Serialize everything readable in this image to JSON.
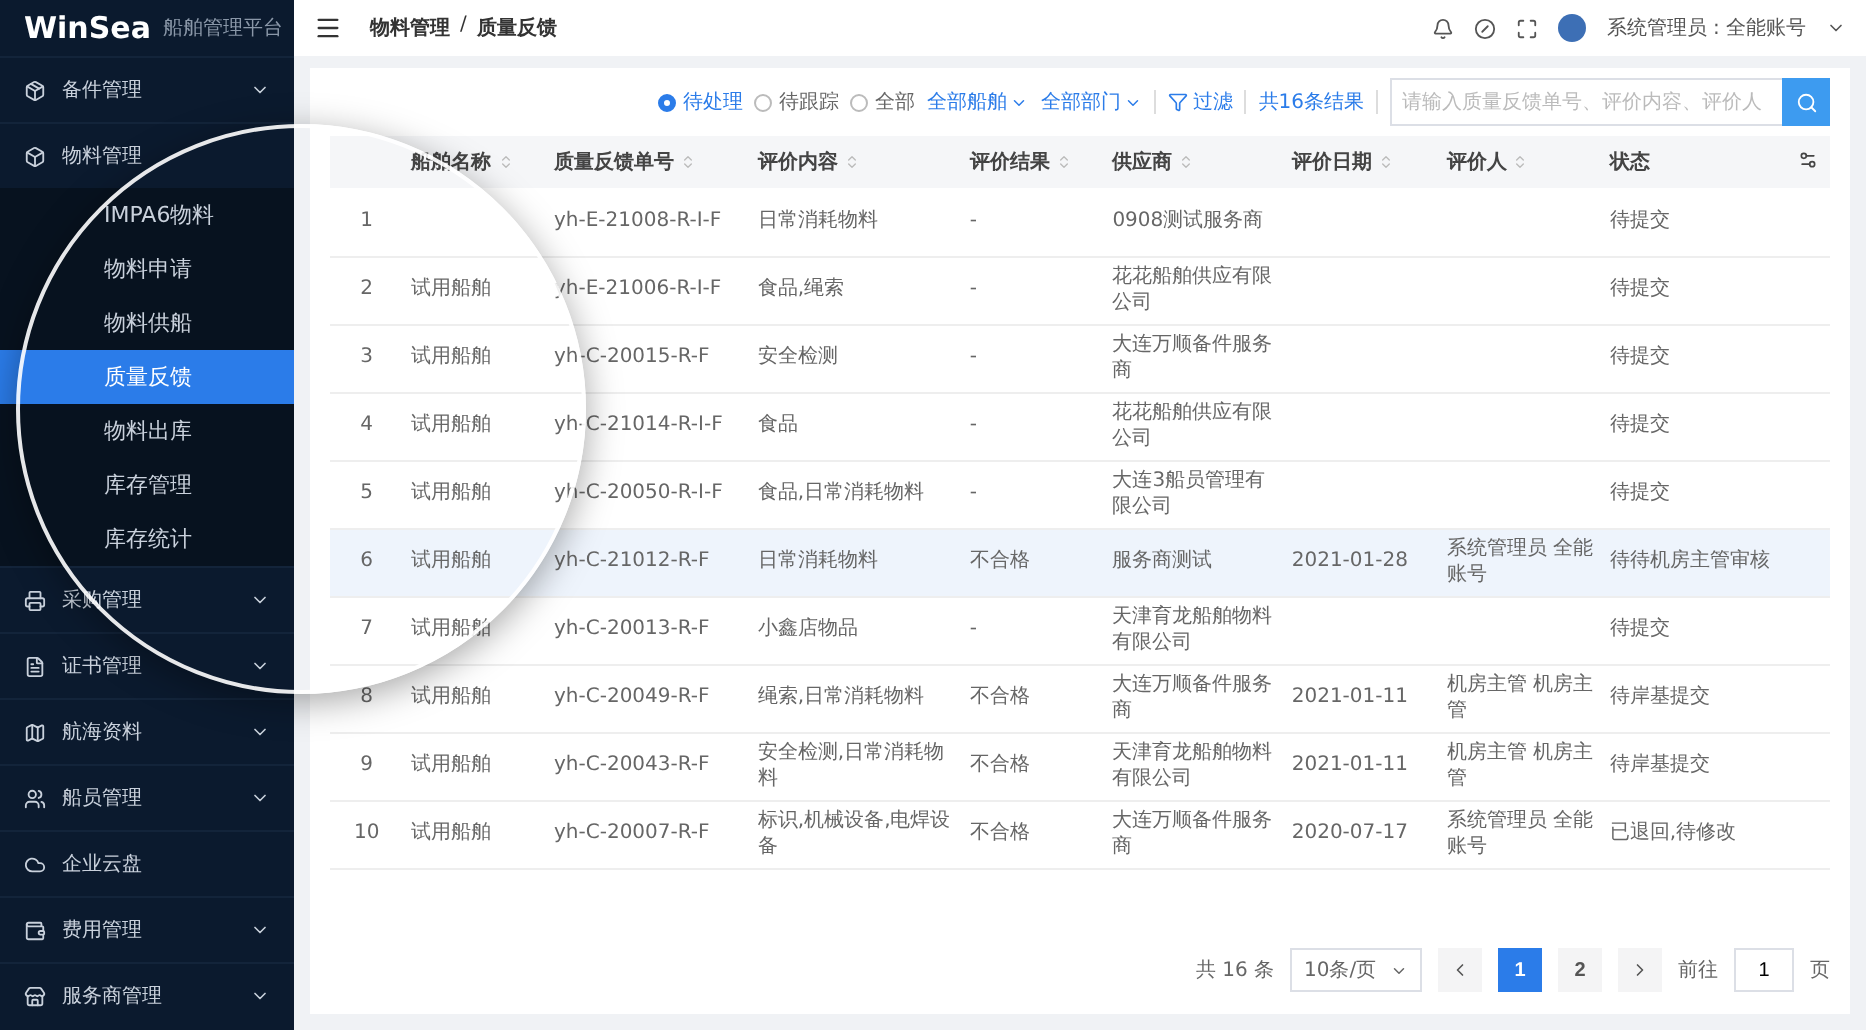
{
  "sidebar": {
    "logo": "WinSea",
    "subtitle": "船舶管理平台",
    "items": [
      {
        "label": "备件管理",
        "arrow": true,
        "expanded": false
      },
      {
        "label": "物料管理",
        "arrow": false,
        "expanded": true,
        "children": [
          {
            "label": "IMPA6物料",
            "selected": false
          },
          {
            "label": "物料申请",
            "selected": false
          },
          {
            "label": "物料供船",
            "selected": false
          },
          {
            "label": "质量反馈",
            "selected": true
          },
          {
            "label": "物料出库",
            "selected": false
          },
          {
            "label": "库存管理",
            "selected": false
          },
          {
            "label": "库存统计",
            "selected": false
          }
        ]
      },
      {
        "label": "采购管理",
        "arrow": true,
        "expanded": false
      },
      {
        "label": "证书管理",
        "arrow": true,
        "expanded": false
      },
      {
        "label": "航海资料",
        "arrow": true,
        "expanded": false
      },
      {
        "label": "船员管理",
        "arrow": true,
        "expanded": false
      },
      {
        "label": "企业云盘",
        "arrow": false,
        "expanded": false
      },
      {
        "label": "费用管理",
        "arrow": true,
        "expanded": false
      },
      {
        "label": "服务商管理",
        "arrow": true,
        "expanded": false
      }
    ]
  },
  "header": {
    "breadcrumb": [
      "物料管理",
      "质量反馈"
    ],
    "separator": "/",
    "user": "系统管理员 : 全能账号"
  },
  "toolbar": {
    "radios": [
      {
        "label": "待处理",
        "selected": true
      },
      {
        "label": "待跟踪",
        "selected": false
      },
      {
        "label": "全部",
        "selected": false
      }
    ],
    "dropdowns": [
      "全部船舶",
      "全部部门"
    ],
    "filter": "过滤",
    "count": "共16条结果",
    "search": {
      "placeholder": "请输入质量反馈单号、评价内容、评价人"
    }
  },
  "table": {
    "columns": [
      "",
      "船舶名称",
      "质量反馈单号",
      "评价内容",
      "评价结果",
      "供应商",
      "评价日期",
      "评价人",
      "状态"
    ],
    "rows": [
      {
        "index": "1",
        "order_no": "yh-E-21008-R-I-F",
        "content": "日常消耗物料",
        "result": "-",
        "supplier": "0908测试服务商",
        "status": "待提交",
        "highlighted": false
      },
      {
        "index": "2",
        "ship": "试用船舶",
        "order_no": "yh-E-21006-R-I-F",
        "content": "食品,绳索",
        "result": "-",
        "supplier": "花花船舶供应有限公司",
        "status": "待提交",
        "highlighted": false
      },
      {
        "index": "3",
        "ship": "试用船舶",
        "order_no": "yh-C-20015-R-F",
        "content": "安全检测",
        "result": "-",
        "supplier": "大连万顺备件服务商",
        "status": "待提交",
        "highlighted": false
      },
      {
        "index": "4",
        "ship": "试用船舶",
        "order_no": "yh-C-21014-R-I-F",
        "content": "食品",
        "result": "-",
        "supplier": "花花船舶供应有限公司",
        "status": "待提交",
        "highlighted": false
      },
      {
        "index": "5",
        "ship": "试用船舶",
        "order_no": "yh-C-20050-R-I-F",
        "content": "食品,日常消耗物料",
        "result": "-",
        "supplier": "大连3船员管理有限公司",
        "status": "待提交",
        "highlighted": false
      },
      {
        "index": "6",
        "ship": "试用船舶",
        "order_no": "yh-C-21012-R-F",
        "content": "日常消耗物料",
        "result": "不合格",
        "supplier": "服务商测试",
        "date": "2021-01-28",
        "evaluator": "系统管理员 全能账号",
        "status": "待待机房主管审核",
        "highlighted": true
      },
      {
        "index": "7",
        "ship": "试用船舶",
        "order_no": "yh-C-20013-R-F",
        "content": "小鑫店物品",
        "result": "-",
        "supplier": "天津育龙船舶物料有限公司",
        "status": "待提交",
        "highlighted": false
      },
      {
        "index": "8",
        "ship": "试用船舶",
        "order_no": "yh-C-20049-R-F",
        "content": "绳索,日常消耗物料",
        "result": "不合格",
        "supplier": "大连万顺备件服务商",
        "date": "2021-01-11",
        "evaluator": "机房主管 机房主管",
        "status": "待岸基提交",
        "highlighted": false
      },
      {
        "index": "9",
        "ship": "试用船舶",
        "order_no": "yh-C-20043-R-F",
        "content": "安全检测,日常消耗物料",
        "result": "不合格",
        "supplier": "天津育龙船舶物料有限公司",
        "date": "2021-01-11",
        "evaluator": "机房主管 机房主管",
        "status": "待岸基提交",
        "highlighted": false
      },
      {
        "index": "10",
        "ship": "试用船舶",
        "order_no": "yh-C-20007-R-F",
        "content": "标识,机械设备,电焊设备",
        "result": "不合格",
        "supplier": "大连万顺备件服务商",
        "date": "2020-07-17",
        "evaluator": "系统管理员 全能账号",
        "status": "已退回,待修改",
        "highlighted": false
      }
    ]
  },
  "pagination": {
    "total": "共 16 条",
    "page_size": "10条/页",
    "pages": [
      {
        "label": "1",
        "selected": true
      },
      {
        "label": "2",
        "selected": false
      }
    ],
    "goto_label": "前往",
    "goto_value": "1",
    "goto_suffix": "页"
  }
}
